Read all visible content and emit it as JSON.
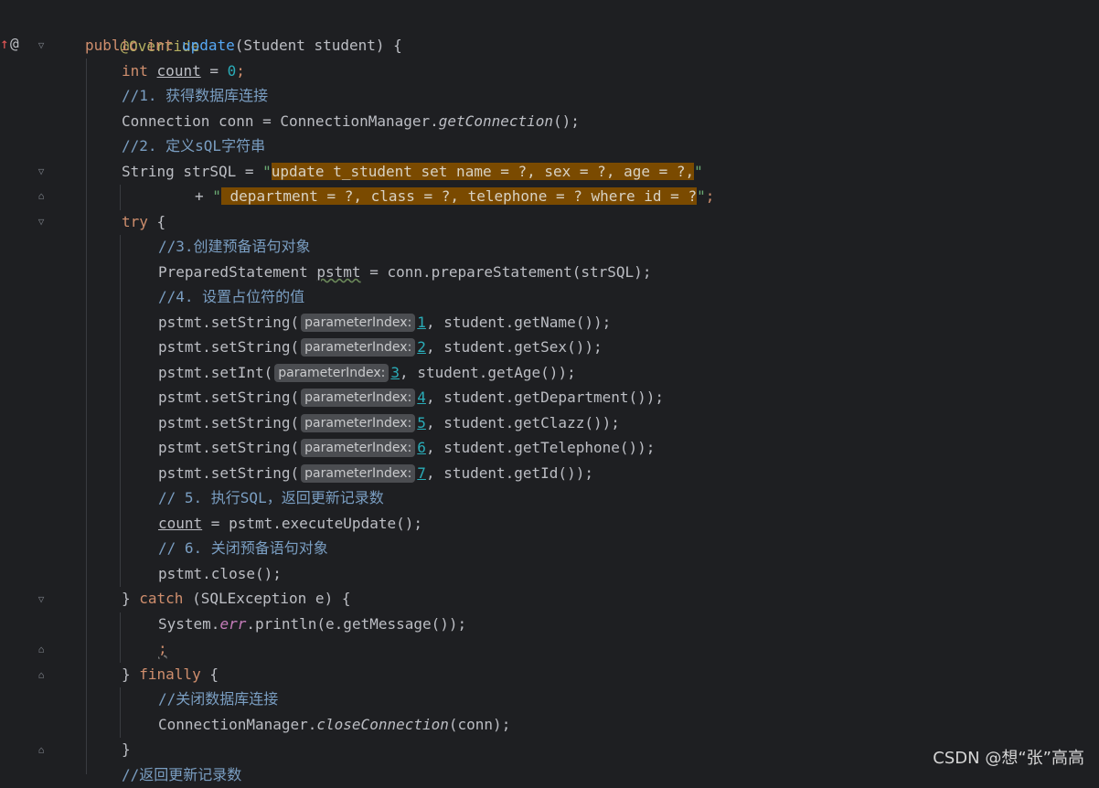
{
  "gutter": {
    "override_marker": "↑",
    "at_marker": "@"
  },
  "code": {
    "l1": "@Override",
    "l2_kw1": "public",
    "l2_kw2": "int",
    "l2_fn": "update",
    "l2_rest": "(Student student) {",
    "l3_kw": "int",
    "l3_var": "count",
    "l3_eq": " = ",
    "l3_num": "0",
    "l3_end": ";",
    "l4": "//1. 获得数据库连接",
    "l5_a": "Connection conn = ConnectionManager.",
    "l5_it": "getConnection",
    "l5_b": "();",
    "l6": "//2. 定义sQL字符串",
    "l7_a": "String strSQL = ",
    "l7_q1": "\"",
    "l7_hl": "update t_student set name = ?, sex = ?, age = ?,",
    "l7_q2": "\"",
    "l8_a": "+ ",
    "l8_q1": "\"",
    "l8_hl": " department = ?, class = ?, telephone = ? where id = ?",
    "l8_q2": "\"",
    "l8_end": ";",
    "l9_kw": "try",
    "l9_rest": " {",
    "l10": "//3.创建预备语句对象",
    "l11_a": "PreparedStatement ",
    "l11_var": "pstmt",
    "l11_b": " = conn.prepareStatement(strSQL);",
    "l12": "//4. 设置占位符的值",
    "hint_label": "parameterIndex:",
    "set_calls": [
      {
        "pre": "pstmt.setString(",
        "num": "1",
        "post": ", student.getName());"
      },
      {
        "pre": "pstmt.setString(",
        "num": "2",
        "post": ", student.getSex());"
      },
      {
        "pre": "pstmt.setInt(",
        "num": "3",
        "post": ", student.getAge());"
      },
      {
        "pre": "pstmt.setString(",
        "num": "4",
        "post": ", student.getDepartment());"
      },
      {
        "pre": "pstmt.setString(",
        "num": "5",
        "post": ", student.getClazz());"
      },
      {
        "pre": "pstmt.setString(",
        "num": "6",
        "post": ", student.getTelephone());"
      },
      {
        "pre": "pstmt.setString(",
        "num": "7",
        "post": ", student.getId());"
      }
    ],
    "l20": "// 5. 执行SQL，返回更新记录数",
    "l21_var": "count",
    "l21_rest": " = pstmt.executeUpdate();",
    "l22": "// 6. 关闭预备语句对象",
    "l23": "pstmt.close();",
    "l24_a": "} ",
    "l24_kw": "catch",
    "l24_b": " (SQLException e) {",
    "l25_a": "System.",
    "l25_fld": "err",
    "l25_b": ".println(e.getMessage());",
    "l26": ";",
    "l27_a": "} ",
    "l27_kw": "finally",
    "l27_b": " {",
    "l28": "//关闭数据库连接",
    "l29_a": "ConnectionManager.",
    "l29_it": "closeConnection",
    "l29_b": "(conn);",
    "l30": "}",
    "l31": "//返回更新记录数"
  },
  "watermark": "CSDN @想“张”高高",
  "colors": {
    "background": "#1e1f22",
    "keyword": "#cf8e6d",
    "comment": "#7a9ec2",
    "highlight": "#7a4a00"
  }
}
